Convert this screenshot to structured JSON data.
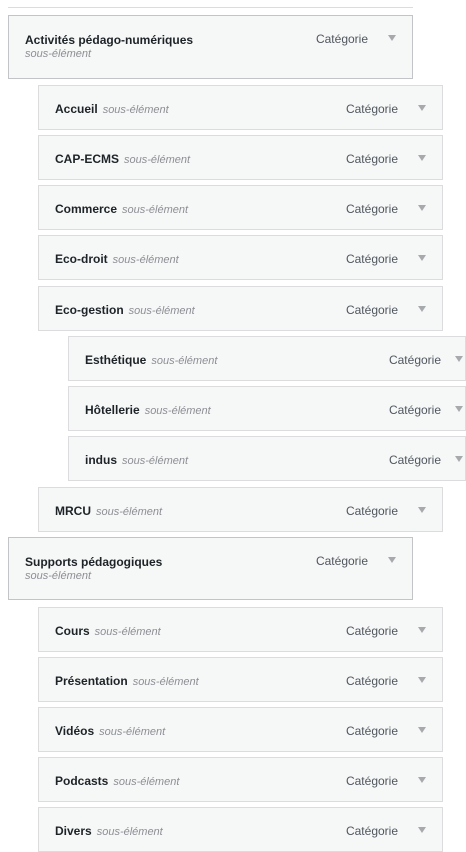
{
  "menu": {
    "items": [
      {
        "title": "Activités pédago-numériques",
        "sub": "sous-élément",
        "type": "Catégorie",
        "arrow": "chevron-down-icon"
      },
      {
        "title": "Accueil",
        "sub": "sous-élément",
        "type": "Catégorie",
        "arrow": "chevron-down-icon"
      },
      {
        "title": "CAP-ECMS",
        "sub": "sous-élément",
        "type": "Catégorie",
        "arrow": "chevron-down-icon"
      },
      {
        "title": "Commerce",
        "sub": "sous-élément",
        "type": "Catégorie",
        "arrow": "chevron-down-icon"
      },
      {
        "title": "Eco-droit",
        "sub": "sous-élément",
        "type": "Catégorie",
        "arrow": "chevron-down-icon"
      },
      {
        "title": "Eco-gestion",
        "sub": "sous-élément",
        "type": "Catégorie",
        "arrow": "chevron-down-icon"
      },
      {
        "title": "Esthétique",
        "sub": "sous-élément",
        "type": "Catégorie",
        "arrow": "chevron-down-icon"
      },
      {
        "title": "Hôtellerie",
        "sub": "sous-élément",
        "type": "Catégorie",
        "arrow": "chevron-down-icon"
      },
      {
        "title": "indus",
        "sub": "sous-élément",
        "type": "Catégorie",
        "arrow": "chevron-down-icon"
      },
      {
        "title": "MRCU",
        "sub": "sous-élément",
        "type": "Catégorie",
        "arrow": "chevron-down-icon"
      },
      {
        "title": "Supports pédagogiques",
        "sub": "sous-élément",
        "type": "Catégorie",
        "arrow": "chevron-down-icon"
      },
      {
        "title": "Cours",
        "sub": "sous-élément",
        "type": "Catégorie",
        "arrow": "chevron-down-icon"
      },
      {
        "title": "Présentation",
        "sub": "sous-élément",
        "type": "Catégorie",
        "arrow": "chevron-down-icon"
      },
      {
        "title": "Vidéos",
        "sub": "sous-élément",
        "type": "Catégorie",
        "arrow": "chevron-down-icon"
      },
      {
        "title": "Podcasts",
        "sub": "sous-élément",
        "type": "Catégorie",
        "arrow": "chevron-down-icon"
      },
      {
        "title": "Divers",
        "sub": "sous-élément",
        "type": "Catégorie",
        "arrow": "chevron-down-icon"
      }
    ]
  },
  "colors": {
    "item_background": "#f6f7f7",
    "border": "#dcdcde",
    "title": "#1d2327",
    "subtitle": "#8c8f94"
  }
}
